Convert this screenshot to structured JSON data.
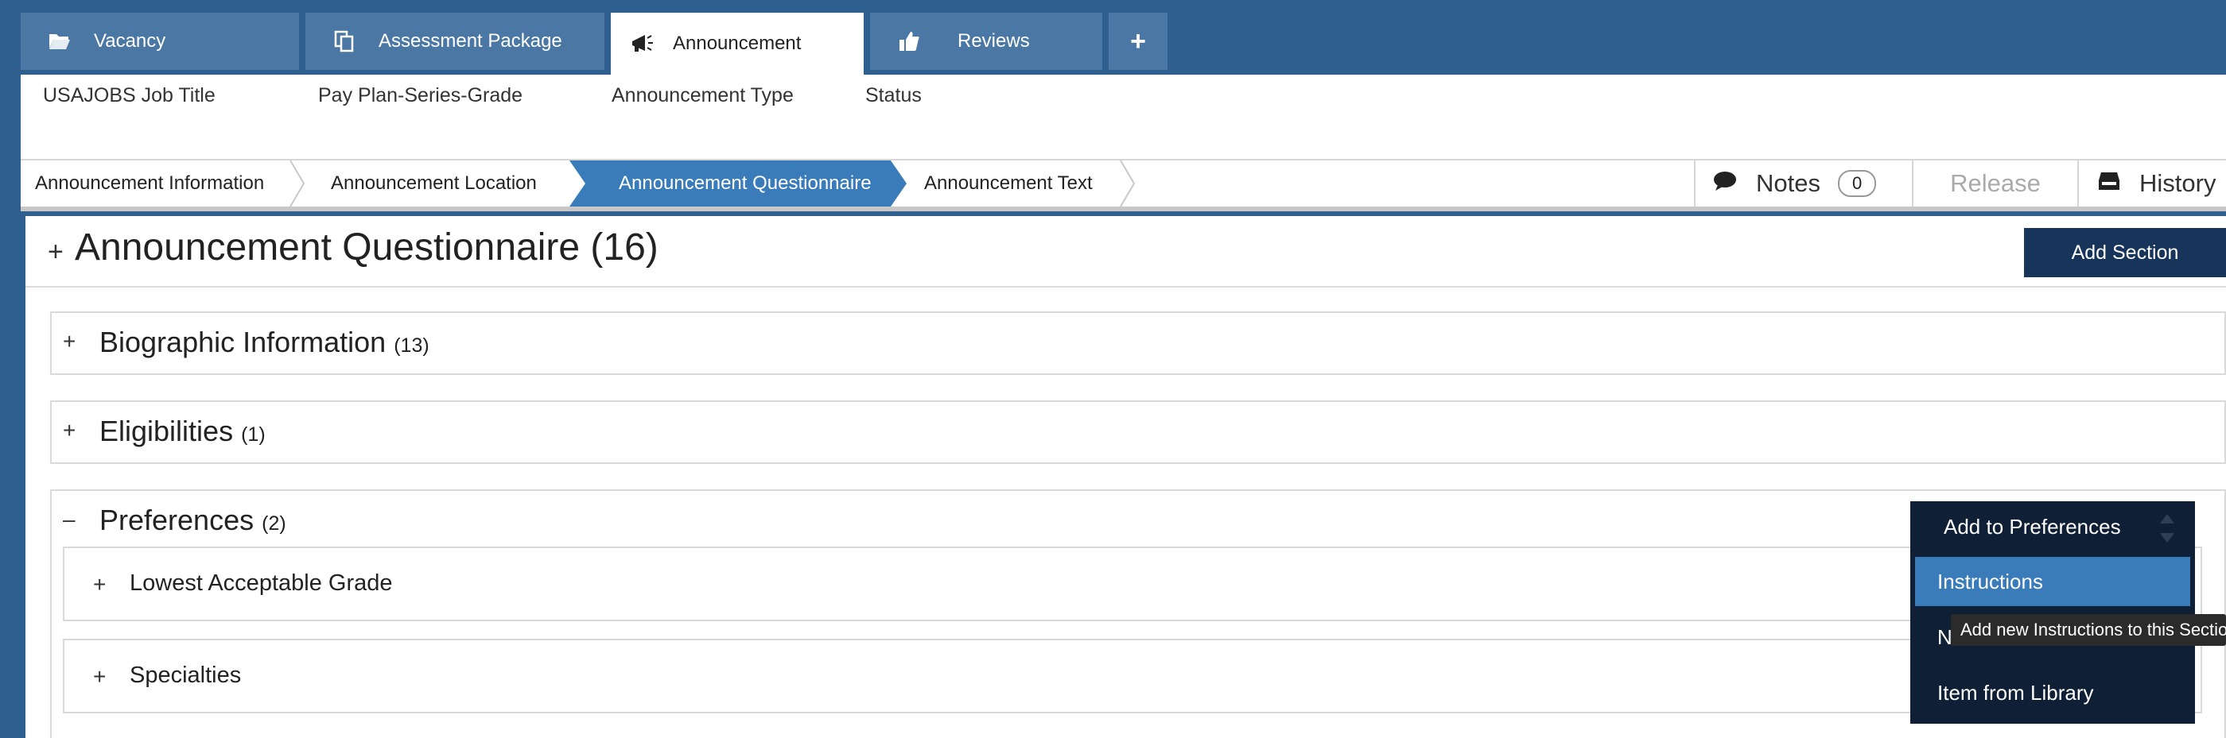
{
  "tabs": [
    {
      "label": "Vacancy",
      "icon": "folder-open-icon"
    },
    {
      "label": "Assessment Package",
      "icon": "copy-documents-icon"
    },
    {
      "label": "Announcement",
      "icon": "megaphone-icon"
    },
    {
      "label": "Reviews",
      "icon": "thumbs-up-icon"
    }
  ],
  "add_tab_label": "+",
  "info": {
    "job_title_label": "USAJOBS Job Title",
    "pay_plan_label": "Pay Plan-Series-Grade",
    "announcement_type_label": "Announcement Type",
    "status_label": "Status"
  },
  "steps": [
    "Announcement Information",
    "Announcement Location",
    "Announcement Questionnaire",
    "Announcement Text"
  ],
  "actions": {
    "notes_label": "Notes",
    "notes_count": "0",
    "release_label": "Release",
    "history_label": "History"
  },
  "questionnaire": {
    "title": "Announcement Questionnaire (16)",
    "add_section_label": "Add Section",
    "sections": [
      {
        "title": "Biographic Information",
        "count": "(13)",
        "toggle": "+"
      },
      {
        "title": "Eligibilities",
        "count": "(1)",
        "toggle": "+"
      },
      {
        "title": "Preferences",
        "count": "(2)",
        "toggle": "–"
      }
    ],
    "preferences_items": [
      "Lowest Acceptable Grade",
      "Specialties"
    ]
  },
  "dropdown": {
    "header": "Add to Preferences",
    "items": [
      "Instructions",
      "New Item",
      "Item from Library"
    ],
    "tooltip": "Add new Instructions to this Section"
  },
  "colors": {
    "top_bar": "#2e5f8e",
    "active_step": "#3a7cba",
    "dark_button": "#17355a"
  }
}
